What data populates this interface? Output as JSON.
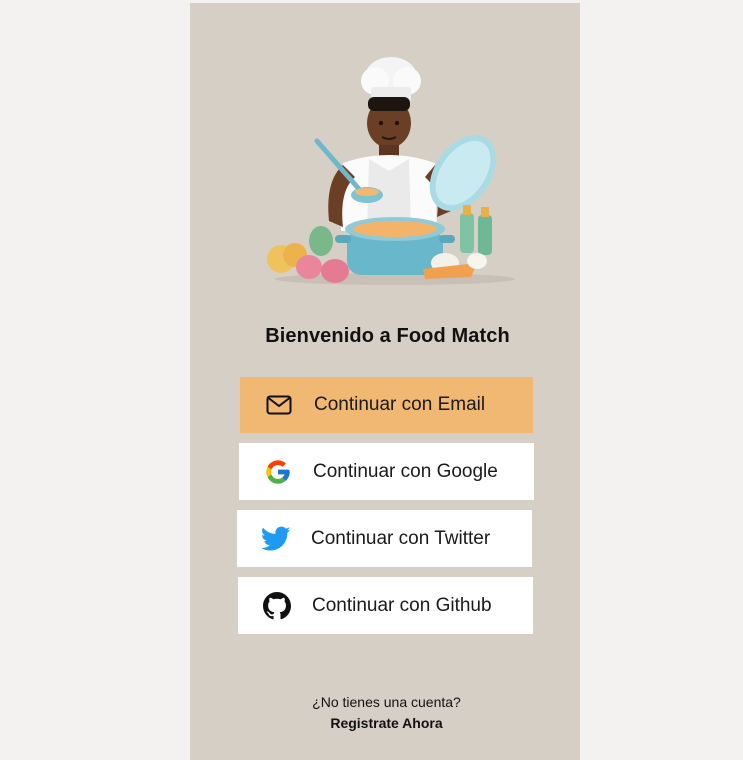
{
  "app": {
    "welcome_title": "Bienvenido a Food Match"
  },
  "hero": {
    "illustration": "chef-cooking-illustration"
  },
  "auth": {
    "email_label": "Continuar con Email",
    "google_label": "Continuar con Google",
    "twitter_label": "Continuar con Twitter",
    "github_label": "Continuar con Github",
    "email_icon": "mail-icon",
    "google_icon": "google-icon",
    "twitter_icon": "twitter-icon",
    "github_icon": "github-icon"
  },
  "footer": {
    "prompt": "¿No tienes una cuenta?",
    "register_link": "Registrate Ahora"
  },
  "colors": {
    "background": "#f3f2f0",
    "panel": "#d6cfc6",
    "email_button": "#f0b873",
    "button": "#ffffff",
    "twitter_blue": "#1d9bf0"
  }
}
